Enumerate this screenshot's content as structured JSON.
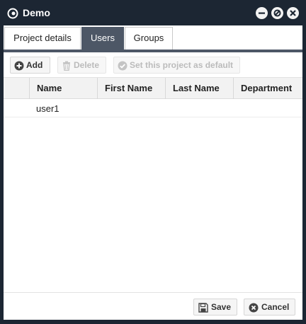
{
  "window": {
    "title": "Demo",
    "controls": [
      "minimize-icon",
      "maximize-icon",
      "close-icon"
    ]
  },
  "tabs": [
    {
      "label": "Project details",
      "active": false
    },
    {
      "label": "Users",
      "active": true
    },
    {
      "label": "Groups",
      "active": false
    }
  ],
  "toolbar": {
    "add_label": "Add",
    "delete_label": "Delete",
    "default_label": "Set this project as default"
  },
  "grid": {
    "columns": [
      "Name",
      "First Name",
      "Last Name",
      "Department"
    ],
    "rows": [
      {
        "name": "user1",
        "first_name": "",
        "last_name": "",
        "department": ""
      }
    ]
  },
  "footer": {
    "save_label": "Save",
    "cancel_label": "Cancel"
  },
  "colors": {
    "titlebar": "#1c2633",
    "active_tab": "#4d5766",
    "panel": "#ffffff"
  }
}
